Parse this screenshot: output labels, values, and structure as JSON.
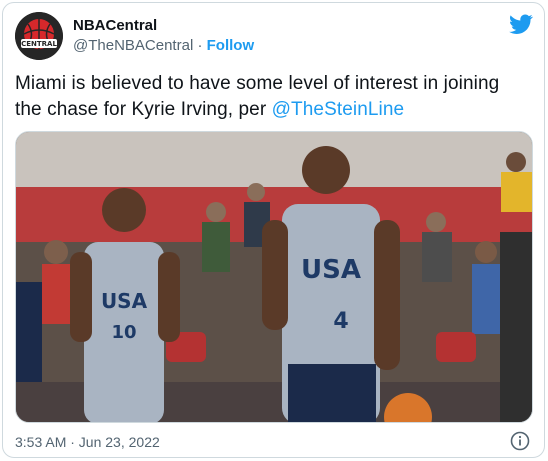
{
  "author": {
    "display_name": "NBACentral",
    "handle": "@TheNBACentral",
    "separator": "·",
    "follow_label": "Follow",
    "avatar_text": "CENTRAL"
  },
  "tweet": {
    "text_before": "Miami is believed to have some level of interest in joining the chase for Kyrie Irving, per ",
    "mention": "@TheSteinLine"
  },
  "photo": {
    "jersey_left": {
      "text": "USA",
      "number": "10"
    },
    "jersey_right": {
      "text": "USA",
      "number": "4"
    }
  },
  "footer": {
    "timestamp": "3:53 AM · Jun 23, 2022"
  },
  "colors": {
    "accent": "#1d9bf0",
    "text": "#0f1419",
    "secondary": "#536471",
    "border": "#cfd9de"
  },
  "icons": {
    "brand": "twitter-bird-icon",
    "info": "info-icon"
  }
}
